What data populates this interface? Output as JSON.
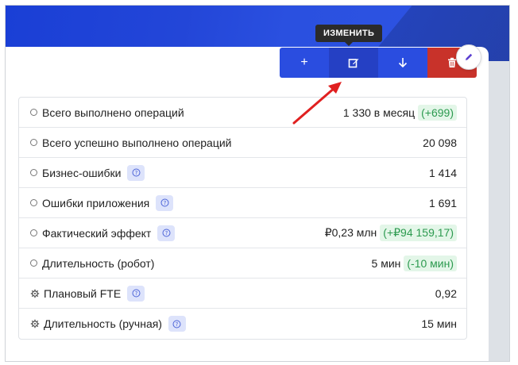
{
  "toolbar": {
    "tooltip_label": "ИЗМЕНИТЬ",
    "buttons": [
      {
        "icon": "plus-icon",
        "label": "+"
      },
      {
        "icon": "edit-icon",
        "label": ""
      },
      {
        "icon": "download-icon",
        "label": ""
      },
      {
        "icon": "trash-icon",
        "label": ""
      }
    ]
  },
  "metrics": [
    {
      "icon": "radio-icon",
      "label": "Всего выполнено операций",
      "help": false,
      "value": "1 330 в месяц",
      "delta": "(+699)"
    },
    {
      "icon": "radio-icon",
      "label": "Всего успешно выполнено операций",
      "help": false,
      "value": "20 098",
      "delta": ""
    },
    {
      "icon": "radio-icon",
      "label": "Бизнес-ошибки",
      "help": true,
      "value": "1 414",
      "delta": ""
    },
    {
      "icon": "radio-icon",
      "label": "Ошибки приложения",
      "help": true,
      "value": "1 691",
      "delta": ""
    },
    {
      "icon": "radio-icon",
      "label": "Фактический эффект",
      "help": true,
      "value": "₽0,23 млн",
      "delta": "(+₽94 159,17)"
    },
    {
      "icon": "radio-icon",
      "label": "Длительность (робот)",
      "help": false,
      "value": "5 мин",
      "delta": "(-10 мин)"
    },
    {
      "icon": "fte-icon",
      "label": "Плановый FTE",
      "help": true,
      "value": "0,92",
      "delta": ""
    },
    {
      "icon": "fte-icon",
      "label": "Длительность (ручная)",
      "help": true,
      "value": "15  мин",
      "delta": ""
    }
  ],
  "colors": {
    "primary": "#2a4de0",
    "primary_active": "#2540c4",
    "danger": "#c8322a",
    "delta_bg": "#e3f6e8",
    "delta_text": "#2c9a4f",
    "help_bg": "#dde3fb",
    "annotation_arrow": "#e02020"
  }
}
